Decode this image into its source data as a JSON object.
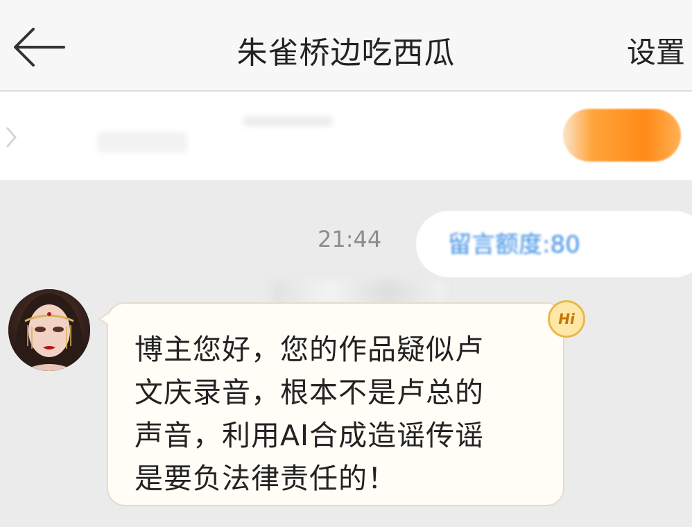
{
  "header": {
    "title": "朱雀桥边吃西瓜",
    "settings_label": "设置"
  },
  "chat": {
    "timestamp": "21:44",
    "quota_text": "留言额度:80",
    "message": {
      "badge": "Hi",
      "lines": [
        "博主您好，您的作品疑似卢",
        "文庆录音，根本不是卢总的",
        "声音，利用AI合成造谣传谣",
        "是要负法律责任的！"
      ]
    }
  }
}
